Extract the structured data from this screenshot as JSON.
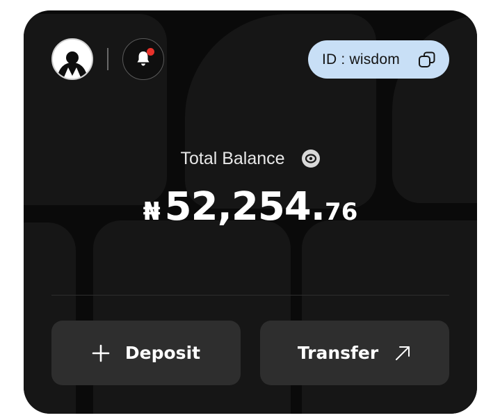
{
  "header": {
    "id_label": "ID : wisdom",
    "notification_indicator_color": "#e8322b"
  },
  "balance": {
    "label": "Total Balance",
    "currency_symbol": "₦",
    "amount_whole": "52,254.",
    "amount_decimal": "76"
  },
  "actions": {
    "deposit_label": "Deposit",
    "transfer_label": "Transfer"
  },
  "icons": {
    "avatar": "user-avatar-icon",
    "bell": "bell-icon",
    "copy": "copy-icon",
    "eye": "eye-icon",
    "plus": "plus-icon",
    "arrow": "arrow-up-right-icon"
  },
  "colors": {
    "card_background": "#0a0a0a",
    "id_pill": "#c8dff6",
    "button_background": "#2e2e2e"
  }
}
